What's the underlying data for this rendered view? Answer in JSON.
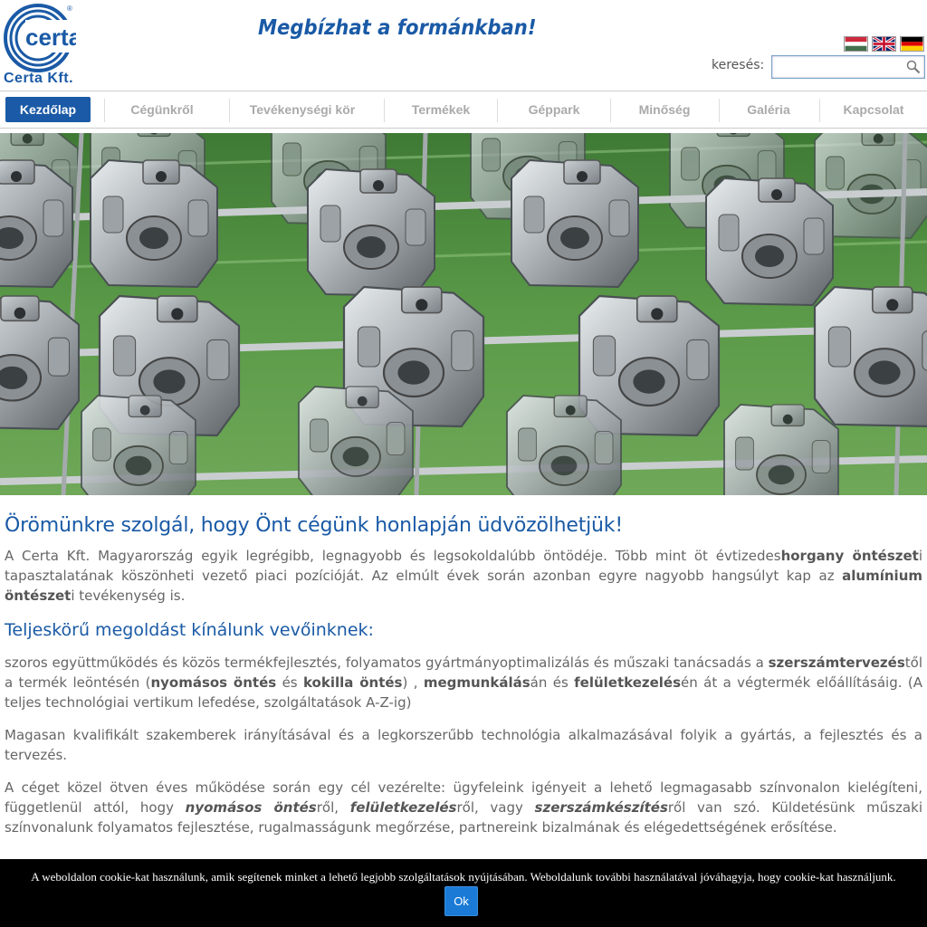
{
  "header": {
    "logo_text": "certa",
    "company": "Certa Kft.",
    "slogan": "Megbízhat a formánkban!",
    "search_label": "keresés:",
    "search_value": "",
    "search_placeholder": "",
    "flags": [
      "hungarian-flag-icon",
      "uk-flag-icon",
      "german-flag-icon"
    ]
  },
  "nav": {
    "items": [
      {
        "label": "Kezdőlap",
        "active": true
      },
      {
        "label": "Cégünkről",
        "active": false
      },
      {
        "label": "Tevékenységi kör",
        "active": false
      },
      {
        "label": "Termékek",
        "active": false
      },
      {
        "label": "Géppark",
        "active": false
      },
      {
        "label": "Minőség",
        "active": false
      },
      {
        "label": "Galéria",
        "active": false
      },
      {
        "label": "Kapcsolat",
        "active": false
      }
    ]
  },
  "hero": {
    "image_icon": "cast-aluminium-parts-photo"
  },
  "content": {
    "title": "Örömünkre szolgál, hogy Önt cégünk honlapján üdvözölhetjük!",
    "p1": {
      "a": "A Certa Kft. Magyarország egyik legrégibb, legnagyobb és legsokoldalúbb öntödéje. Több mint öt évtizedes",
      "b": "horgany öntészet",
      "c": "i tapasztalatának köszönheti vezető piaci pozícióját. Az elmúlt évek során azonban egyre nagyobb hangsúlyt kap az ",
      "d": "alumínium öntészet",
      "e": "i tevékenység is."
    },
    "subtitle": "Teljeskörű megoldást kínálunk vevőinknek:",
    "p2": {
      "a": "szoros együttműködés és közös termékfejlesztés, folyamatos gyártmányoptimalizálás és műszaki tanácsadás a ",
      "b": "szerszámtervezés",
      "c": "től a termék leöntésén (",
      "d": "nyomásos öntés",
      "e": " és ",
      "f": "kokilla öntés",
      "g": ") , ",
      "h": "megmunkálás",
      "i": "án és ",
      "j": "felületkezelés",
      "k": "én át a végtermék előállításáig. (A teljes technológiai vertikum lefedése, szolgáltatások A-Z-ig)"
    },
    "p3": "Magasan kvalifikált szakemberek irányításával és a legkorszerűbb technológia alkalmazásával folyik a gyártás, a fejlesztés és a tervezés.",
    "p4": {
      "a": "A céget közel ötven éves működése során egy cél vezérelte: ügyfeleink igényeit a lehető legmagasabb színvonalon kielégíteni, függetlenül attól, hogy ",
      "b": "nyomásos öntés",
      "c": "ről, ",
      "d": "felületkezelés",
      "e": "ről, vagy ",
      "f": "szerszámkészítés",
      "g": "ről van szó. Küldetésünk műszaki színvonalunk folyamatos fejlesztése, rugalmasságunk megőrzése, partnereink bizalmának és elégedettségének erősítése."
    }
  },
  "cookie": {
    "text": "A weboldalon cookie-kat használunk, amik segítenek minket a lehető legjobb szolgáltatások nyújtásában. Weboldalunk további használatával jóváhagyja, hogy cookie-kat használjunk.",
    "ok_label": "Ok"
  },
  "colors": {
    "brand": "#1a5aa6",
    "nav_inactive": "#aaaaaa",
    "cookie_bg": "#000000",
    "ok_button": "#1a7ad6"
  }
}
